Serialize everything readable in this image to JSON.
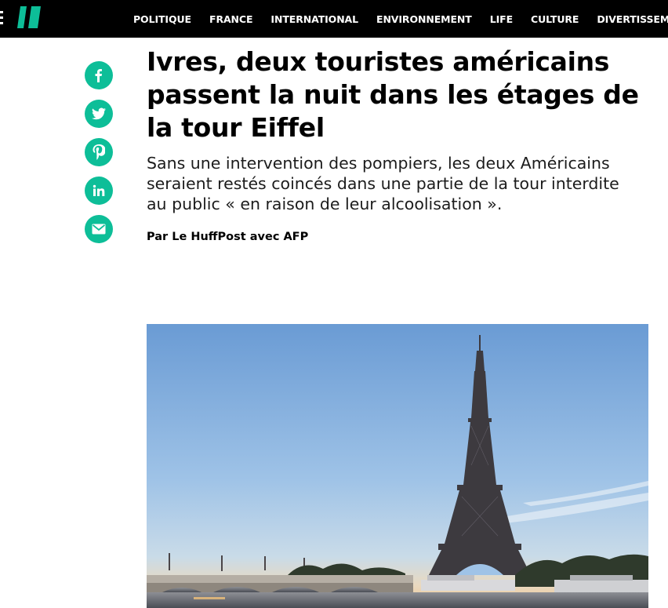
{
  "nav": {
    "items": [
      "POLITIQUE",
      "FRANCE",
      "INTERNATIONAL",
      "ENVIRONNEMENT",
      "LIFE",
      "CULTURE",
      "DIVERTISSEMENT"
    ]
  },
  "share": {
    "icons": [
      "facebook-icon",
      "twitter-icon",
      "pinterest-icon",
      "linkedin-icon",
      "email-icon"
    ],
    "accent": "#0dbe98"
  },
  "article": {
    "headline": "Ivres, deux touristes américains passent la nuit dans les étages de la tour Eiffel",
    "dek": "Sans une intervention des pompiers, les deux Américains seraient restés coincés dans une partie de la tour interdite au public « en raison de leur alcoolisation ».",
    "byline": "Par Le HuffPost avec AFP"
  },
  "colors": {
    "topbar": "#000000",
    "brand": "#0dbe98"
  }
}
